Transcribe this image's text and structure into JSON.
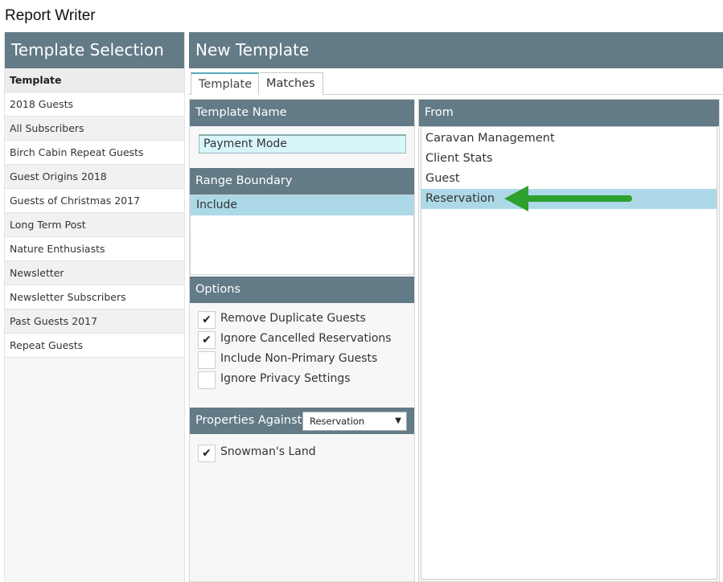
{
  "app": {
    "title": "Report Writer"
  },
  "left_panel": {
    "title": "Template Selection",
    "items": [
      "Template",
      "2018 Guests",
      "All Subscribers",
      "Birch Cabin Repeat Guests",
      "Guest Origins 2018",
      "Guests of Christmas 2017",
      "Long Term Post",
      "Nature Enthusiasts",
      "Newsletter",
      "Newsletter Subscribers",
      "Past Guests 2017",
      "Repeat Guests"
    ]
  },
  "right_panel": {
    "title": "New Template",
    "tabs": [
      {
        "label": "Template",
        "active": true
      },
      {
        "label": "Matches",
        "active": false
      }
    ],
    "template_name": {
      "label": "Template Name",
      "value": "Payment Mode"
    },
    "range_boundary": {
      "label": "Range Boundary",
      "items": [
        {
          "label": "Include",
          "selected": true
        }
      ]
    },
    "options": {
      "label": "Options",
      "items": [
        {
          "label": "Remove Duplicate Guests",
          "checked": true,
          "mark": "✔"
        },
        {
          "label": "Ignore Cancelled Reservations",
          "checked": true,
          "mark": "✔"
        },
        {
          "label": "Include Non-Primary Guests",
          "checked": false,
          "mark": ""
        },
        {
          "label": "Ignore Privacy Settings",
          "checked": false,
          "mark": ""
        }
      ]
    },
    "properties": {
      "label": "Properties Against",
      "selected": "Reservation",
      "items": [
        {
          "label": "Snowman's Land",
          "checked": true,
          "mark": "✔"
        }
      ]
    },
    "from": {
      "label": "From",
      "items": [
        {
          "label": "Caravan Management",
          "selected": false
        },
        {
          "label": "Client Stats",
          "selected": false
        },
        {
          "label": "Guest",
          "selected": false
        },
        {
          "label": "Reservation",
          "selected": true
        }
      ]
    }
  },
  "annotation": {
    "icon": "arrow-left-icon",
    "color": "#2ea02e"
  },
  "colors": {
    "header": "#637a87",
    "selected": "#acd8e8",
    "input_bg": "#d8f5fa",
    "tab_accent": "#5aa9c3"
  }
}
